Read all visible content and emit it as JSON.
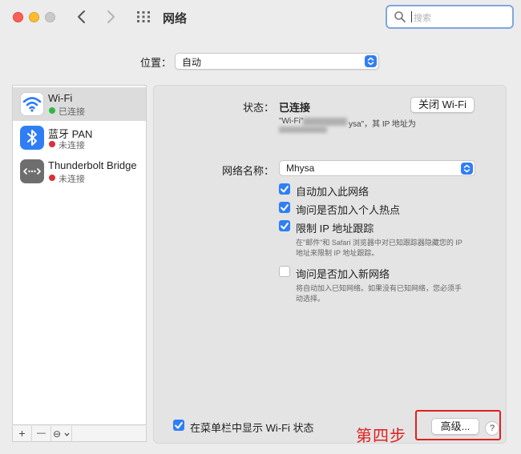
{
  "window": {
    "title": "网络",
    "search_placeholder": "搜索"
  },
  "location": {
    "label": "位置：",
    "value": "自动"
  },
  "services": [
    {
      "name": "Wi-Fi",
      "status": "已连接",
      "status_color": "#2fb844",
      "icon": "wifi-icon"
    },
    {
      "name": "蓝牙 PAN",
      "status": "未连接",
      "status_color": "#d9303a",
      "icon": "bluetooth-icon"
    },
    {
      "name": "Thunderbolt Bridge",
      "status": "未连接",
      "status_color": "#d9303a",
      "icon": "thunderbolt-bridge-icon"
    }
  ],
  "sidebar_buttons": {
    "add": "+",
    "remove": "—",
    "more": "⊖"
  },
  "status": {
    "label": "状态：",
    "value": "已连接",
    "toggle_button": "关闭 Wi-Fi",
    "desc_line1_start": "\"Wi-Fi\"",
    "desc_line1_end": "ysa\"，其 IP 地址为"
  },
  "network_name": {
    "label": "网络名称：",
    "value": "Mhysa"
  },
  "options": [
    {
      "label": "自动加入此网络",
      "checked": true
    },
    {
      "label": "询问是否加入个人热点",
      "checked": true
    },
    {
      "label": "限制 IP 地址跟踪",
      "checked": true
    },
    {
      "label": "询问是否加入新网络",
      "checked": false
    }
  ],
  "notes": {
    "ip_tracking_line1": "在\"邮件\"和 Safari 浏览器中对已知跟踪器隐藏您的 IP",
    "ip_tracking_line2": "地址来限制 IP 地址跟踪。",
    "new_networks_line1": "将自动加入已知网络。如果没有已知网络，您必须手",
    "new_networks_line2": "动选择。"
  },
  "menubar_option": {
    "label": "在菜单栏中显示 Wi-Fi 状态",
    "checked": true
  },
  "advanced_button": "高级...",
  "help_button": "?",
  "annotation": "第四步",
  "colors": {
    "accent": "#2f7ef6",
    "annotation": "#e02020"
  }
}
